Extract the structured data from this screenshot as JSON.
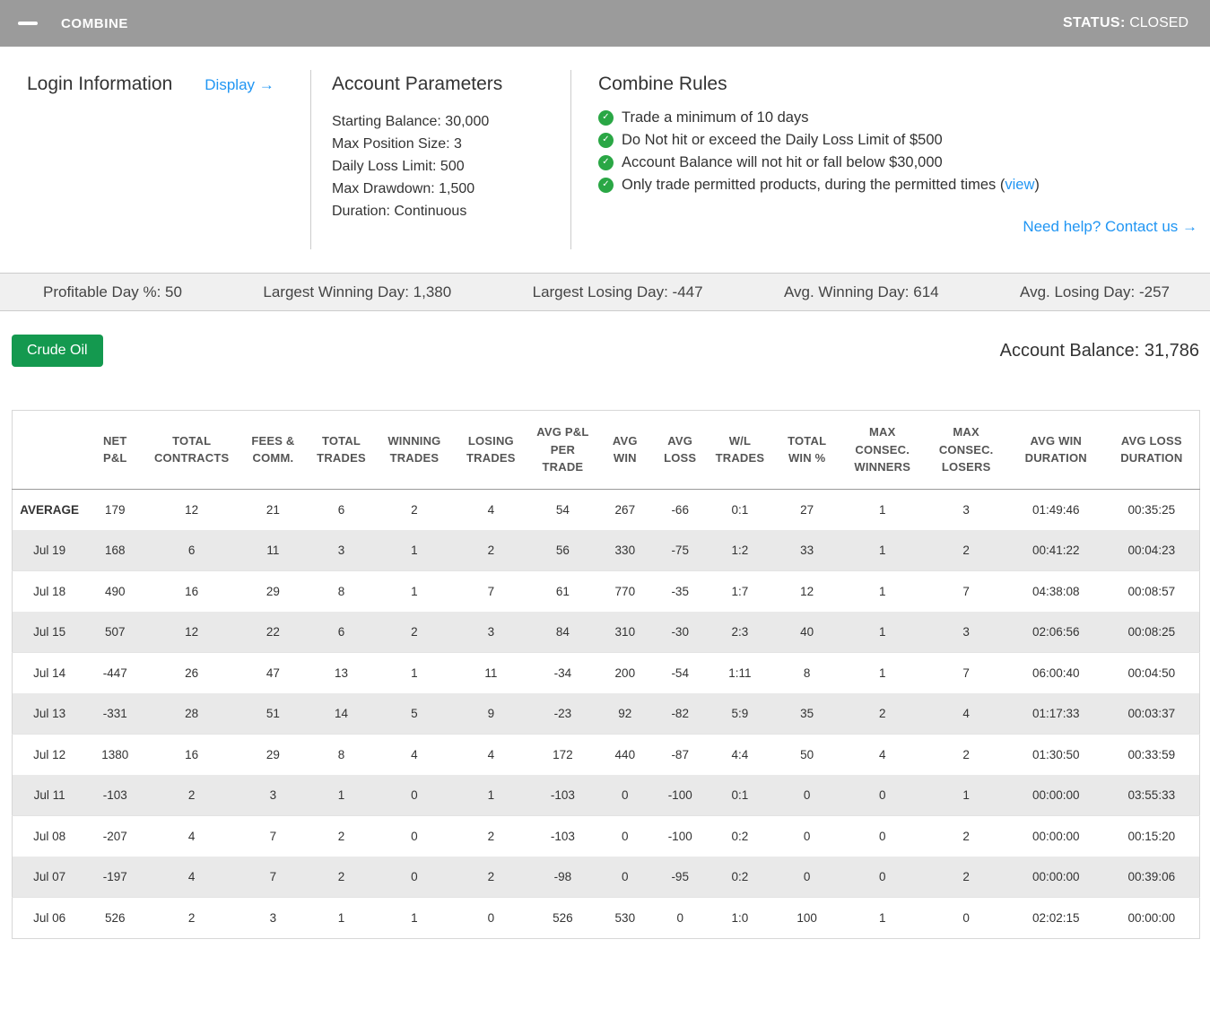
{
  "colors": {
    "accent_blue": "#2196f3",
    "check_green": "#2aa745",
    "button_green": "#14994f",
    "header_gray": "#9b9b9b"
  },
  "header": {
    "title": "COMBINE",
    "status_label": "STATUS:",
    "status_value": "CLOSED"
  },
  "login": {
    "title": "Login Information",
    "display_link": "Display →"
  },
  "account_parameters": {
    "title": "Account Parameters",
    "items": [
      "Starting Balance: 30,000",
      "Max Position Size: 3",
      "Daily Loss Limit: 500",
      "Max Drawdown: 1,500",
      "Duration: Continuous"
    ]
  },
  "combine_rules": {
    "title": "Combine Rules",
    "rules": [
      {
        "text": "Trade a minimum of 10 days",
        "link": "",
        "suffix": ""
      },
      {
        "text": "Do Not hit or exceed the Daily Loss Limit of $500",
        "link": "",
        "suffix": ""
      },
      {
        "text": "Account Balance will not hit or fall below $30,000",
        "link": "",
        "suffix": ""
      },
      {
        "text": "Only trade permitted products, during the permitted times (",
        "link": "view",
        "suffix": ")"
      }
    ],
    "help_link": "Need help? Contact us →"
  },
  "stats": [
    "Profitable Day %: 50",
    "Largest Winning Day: 1,380",
    "Largest Losing Day: -447",
    "Avg. Winning Day: 614",
    "Avg. Losing Day: -257"
  ],
  "product_button": "Crude Oil",
  "account_balance": "Account Balance: 31,786",
  "table": {
    "headers": [
      "",
      "NET P&L",
      "TOTAL CONTRACTS",
      "FEES & COMM.",
      "TOTAL TRADES",
      "WINNING TRADES",
      "LOSING TRADES",
      "AVG P&L PER TRADE",
      "AVG WIN",
      "AVG LOSS",
      "W/L TRADES",
      "TOTAL WIN %",
      "MAX CONSEC. WINNERS",
      "MAX CONSEC. LOSERS",
      "AVG WIN DURATION",
      "AVG LOSS DURATION"
    ],
    "rows": [
      {
        "label": "AVERAGE",
        "bold": true,
        "values": [
          "179",
          "12",
          "21",
          "6",
          "2",
          "4",
          "54",
          "267",
          "-66",
          "0:1",
          "27",
          "1",
          "3",
          "01:49:46",
          "00:35:25"
        ]
      },
      {
        "label": "Jul 19",
        "bold": false,
        "values": [
          "168",
          "6",
          "11",
          "3",
          "1",
          "2",
          "56",
          "330",
          "-75",
          "1:2",
          "33",
          "1",
          "2",
          "00:41:22",
          "00:04:23"
        ]
      },
      {
        "label": "Jul 18",
        "bold": false,
        "values": [
          "490",
          "16",
          "29",
          "8",
          "1",
          "7",
          "61",
          "770",
          "-35",
          "1:7",
          "12",
          "1",
          "7",
          "04:38:08",
          "00:08:57"
        ]
      },
      {
        "label": "Jul 15",
        "bold": false,
        "values": [
          "507",
          "12",
          "22",
          "6",
          "2",
          "3",
          "84",
          "310",
          "-30",
          "2:3",
          "40",
          "1",
          "3",
          "02:06:56",
          "00:08:25"
        ]
      },
      {
        "label": "Jul 14",
        "bold": false,
        "values": [
          "-447",
          "26",
          "47",
          "13",
          "1",
          "11",
          "-34",
          "200",
          "-54",
          "1:11",
          "8",
          "1",
          "7",
          "06:00:40",
          "00:04:50"
        ]
      },
      {
        "label": "Jul 13",
        "bold": false,
        "values": [
          "-331",
          "28",
          "51",
          "14",
          "5",
          "9",
          "-23",
          "92",
          "-82",
          "5:9",
          "35",
          "2",
          "4",
          "01:17:33",
          "00:03:37"
        ]
      },
      {
        "label": "Jul 12",
        "bold": false,
        "values": [
          "1380",
          "16",
          "29",
          "8",
          "4",
          "4",
          "172",
          "440",
          "-87",
          "4:4",
          "50",
          "4",
          "2",
          "01:30:50",
          "00:33:59"
        ]
      },
      {
        "label": "Jul 11",
        "bold": false,
        "values": [
          "-103",
          "2",
          "3",
          "1",
          "0",
          "1",
          "-103",
          "0",
          "-100",
          "0:1",
          "0",
          "0",
          "1",
          "00:00:00",
          "03:55:33"
        ]
      },
      {
        "label": "Jul 08",
        "bold": false,
        "values": [
          "-207",
          "4",
          "7",
          "2",
          "0",
          "2",
          "-103",
          "0",
          "-100",
          "0:2",
          "0",
          "0",
          "2",
          "00:00:00",
          "00:15:20"
        ]
      },
      {
        "label": "Jul 07",
        "bold": false,
        "values": [
          "-197",
          "4",
          "7",
          "2",
          "0",
          "2",
          "-98",
          "0",
          "-95",
          "0:2",
          "0",
          "0",
          "2",
          "00:00:00",
          "00:39:06"
        ]
      },
      {
        "label": "Jul 06",
        "bold": false,
        "values": [
          "526",
          "2",
          "3",
          "1",
          "1",
          "0",
          "526",
          "530",
          "0",
          "1:0",
          "100",
          "1",
          "0",
          "02:02:15",
          "00:00:00"
        ]
      }
    ]
  }
}
